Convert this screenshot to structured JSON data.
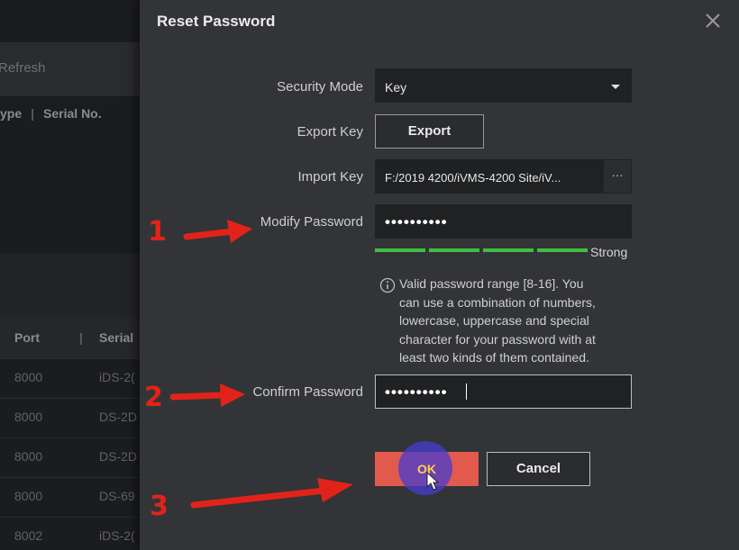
{
  "background": {
    "refresh": "Refresh",
    "header_type": "ype",
    "header_serial": "Serial No.",
    "col_port": "Port",
    "col_serial": "Serial",
    "rows": [
      {
        "port": "8000",
        "serial": "iDS-2("
      },
      {
        "port": "8000",
        "serial": "DS-2D"
      },
      {
        "port": "8000",
        "serial": "DS-2D"
      },
      {
        "port": "8000",
        "serial": "DS-69"
      },
      {
        "port": "8002",
        "serial": "iDS-2("
      }
    ]
  },
  "dialog": {
    "title": "Reset Password",
    "security_mode_label": "Security Mode",
    "security_mode_value": "Key",
    "export_key_label": "Export Key",
    "export_button": "Export",
    "import_key_label": "Import Key",
    "import_key_value": "F:/2019 4200/iVMS-4200 Site/iV...",
    "browse_button": "···",
    "modify_password_label": "Modify Password",
    "modify_password_value": "••••••••••",
    "strength_label": "Strong",
    "strength_level": "4/4",
    "hint_lines": [
      "Valid password range [8-16]. You",
      "can use a combination of numbers,",
      "lowercase, uppercase and special",
      "character for your password with at",
      "least two kinds of them contained."
    ],
    "confirm_password_label": "Confirm Password",
    "confirm_password_value": "••••••••••",
    "ok_button": "OK",
    "cancel_button": "Cancel"
  },
  "annotations": {
    "step1": "1",
    "step2": "2",
    "step3": "3",
    "color": "#e2231a"
  },
  "icons": [
    "close-icon",
    "dropdown-caret-icon",
    "info-icon",
    "cursor-icon",
    "arrow-icon"
  ]
}
